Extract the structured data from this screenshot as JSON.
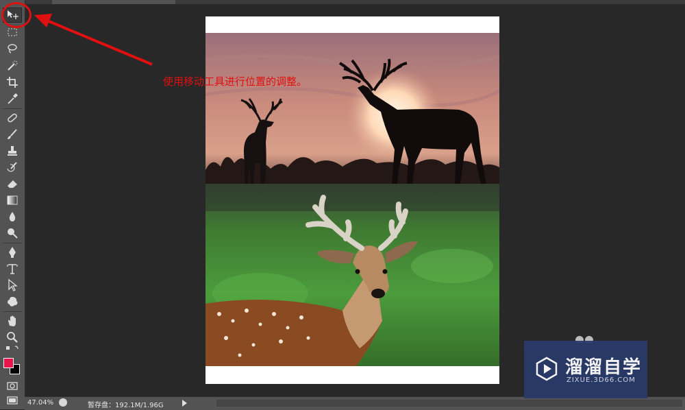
{
  "app": {
    "document_tab": ""
  },
  "toolbar": {
    "tools": [
      "move-icon",
      "marquee-icon",
      "lasso-icon",
      "quick-select-icon",
      "crop-icon",
      "eyedropper-icon",
      "healing-brush-icon",
      "brush-icon",
      "clone-stamp-icon",
      "history-brush-icon",
      "eraser-icon",
      "gradient-icon",
      "blur-icon",
      "dodge-icon",
      "pen-icon",
      "type-icon",
      "path-select-icon",
      "shape-icon",
      "hand-icon",
      "zoom-icon"
    ],
    "active_tool": "move-icon",
    "foreground_color": "#e8154a",
    "background_color": "#000000"
  },
  "annotation": {
    "text": "使用移动工具进行位置的调整。",
    "color": "#e01010"
  },
  "status": {
    "zoom": "47.04%",
    "scratch": "暂存盘：192.1M/1.96G"
  },
  "watermark": {
    "title": "溜溜自学",
    "subtitle": "ZIXUE.3D66.COM"
  }
}
